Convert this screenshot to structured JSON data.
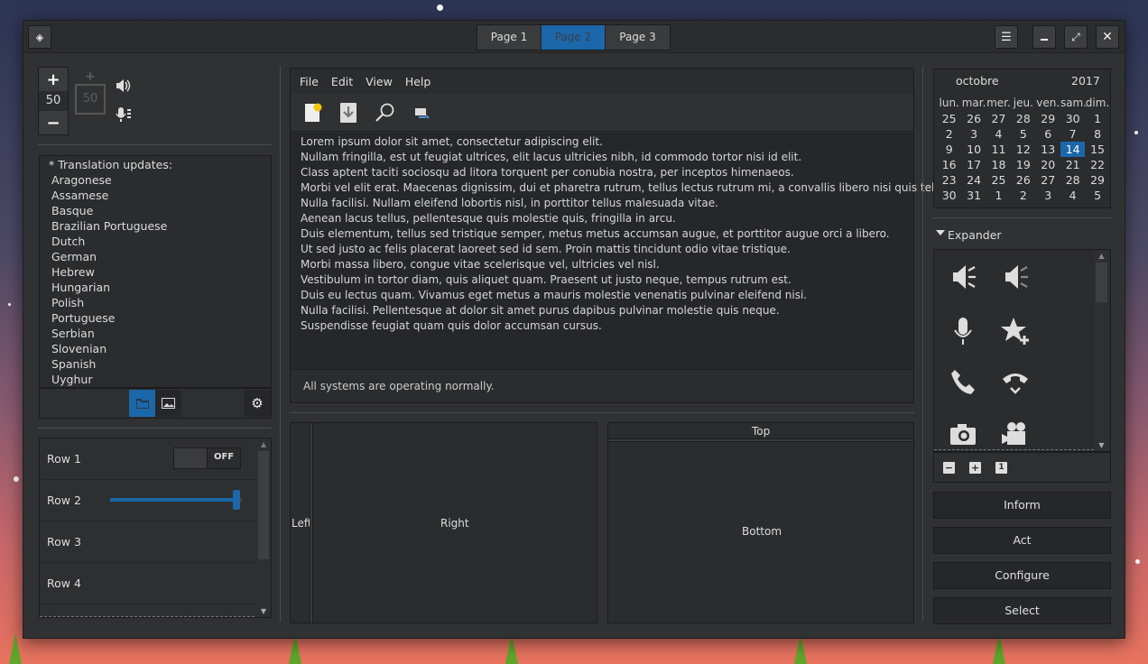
{
  "tabs": [
    "Page 1",
    "Page 2",
    "Page 3"
  ],
  "spinner": {
    "value": "50",
    "disabled_value": "50",
    "plus": "+",
    "minus": "−"
  },
  "languages": {
    "header": "* Translation updates:",
    "items": [
      "Aragonese",
      "Assamese",
      "Basque",
      "Brazilian Portuguese",
      "Dutch",
      "German",
      "Hebrew",
      "Hungarian",
      "Polish",
      "Portuguese",
      "Serbian",
      "Slovenian",
      "Spanish",
      "Uyghur"
    ]
  },
  "rows": [
    {
      "label": "Row 1",
      "switch_label": "OFF"
    },
    {
      "label": "Row 2",
      "slider_fraction": 0.96
    },
    {
      "label": "Row 3"
    },
    {
      "label": "Row 4"
    }
  ],
  "menu": [
    "File",
    "Edit",
    "View",
    "Help"
  ],
  "text_lines": [
    "Lorem ipsum dolor sit amet, consectetur adipiscing elit.",
    "Nullam fringilla, est ut feugiat ultrices, elit lacus ultricies nibh, id commodo tortor nisi id elit.",
    "Class aptent taciti sociosqu ad litora torquent per conubia nostra, per inceptos himenaeos.",
    "Morbi vel elit erat. Maecenas dignissim, dui et pharetra rutrum, tellus lectus rutrum mi, a convallis libero nisi quis tellus.",
    "Nulla facilisi. Nullam eleifend lobortis nisl, in porttitor tellus malesuada vitae.",
    "Aenean lacus tellus, pellentesque quis molestie quis, fringilla in arcu.",
    "Duis elementum, tellus sed tristique semper, metus metus accumsan augue, et porttitor augue orci a libero.",
    "Ut sed justo ac felis placerat laoreet sed id sem. Proin mattis tincidunt odio vitae tristique.",
    "Morbi massa libero, congue vitae scelerisque vel, ultricies vel nisl.",
    "Vestibulum in tortor diam, quis aliquet quam. Praesent ut justo neque, tempus rutrum est.",
    "Duis eu lectus quam. Vivamus eget metus a mauris molestie venenatis pulvinar eleifend nisi.",
    "Nulla facilisi. Pellentesque at dolor sit amet purus dapibus pulvinar molestie quis neque.",
    "Suspendisse feugiat quam quis dolor accumsan cursus."
  ],
  "status_text": "All systems are operating normally.",
  "panes": {
    "left": "Left",
    "right": "Right",
    "top": "Top",
    "bottom": "Bottom"
  },
  "calendar": {
    "month": "octobre",
    "year": "2017",
    "weekdays": [
      "lun.",
      "mar.",
      "mer.",
      "jeu.",
      "ven.",
      "sam.",
      "dim."
    ],
    "weeks": [
      [
        "25",
        "26",
        "27",
        "28",
        "29",
        "30",
        "1"
      ],
      [
        "2",
        "3",
        "4",
        "5",
        "6",
        "7",
        "8"
      ],
      [
        "9",
        "10",
        "11",
        "12",
        "13",
        "14",
        "15"
      ],
      [
        "16",
        "17",
        "18",
        "19",
        "20",
        "21",
        "22"
      ],
      [
        "23",
        "24",
        "25",
        "26",
        "27",
        "28",
        "29"
      ],
      [
        "30",
        "31",
        "1",
        "2",
        "3",
        "4",
        "5"
      ]
    ],
    "selected_day": "14"
  },
  "expander_label": "Expander",
  "icon_names": [
    "audio-volume-muted-icon",
    "audio-volume-low-icon",
    "microphone-icon",
    "star-add-icon",
    "phone-icon",
    "call-hangup-icon",
    "camera-icon",
    "video-camera-icon"
  ],
  "action_buttons": [
    "Inform",
    "Act",
    "Configure",
    "Select"
  ],
  "colors": {
    "accent": "#1b67a9",
    "window_bg": "#303133",
    "view_bg": "#2b2c2e",
    "text": "#d8d8d8"
  }
}
